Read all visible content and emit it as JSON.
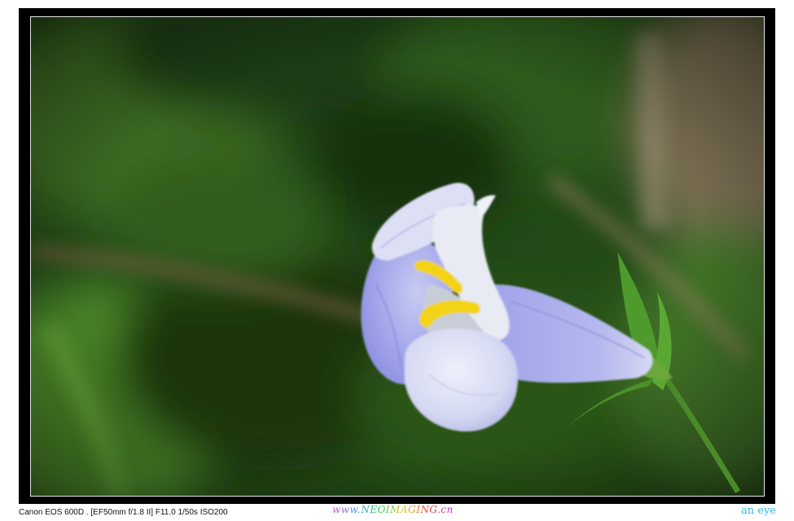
{
  "caption": {
    "exif": "Canon EOS 600D . [EF50mm f/1.8 II] F11.0 1/50s ISO200",
    "site": "www.NEOIMAGING.cn",
    "signature": "an eye"
  },
  "colors": {
    "frame": "#000000",
    "inner_border": "#e6e6e6",
    "petal_light": "#dfe3f5",
    "petal_violet": "#9b9ee6",
    "stamen": "#f0d21a",
    "foliage_dark": "#16310f",
    "foliage_mid": "#3d6b22"
  },
  "subject": {
    "flower-icon": "blue-violet tubular flower with yellow stamens",
    "leaf-icon": "green leaves, blurred background"
  }
}
